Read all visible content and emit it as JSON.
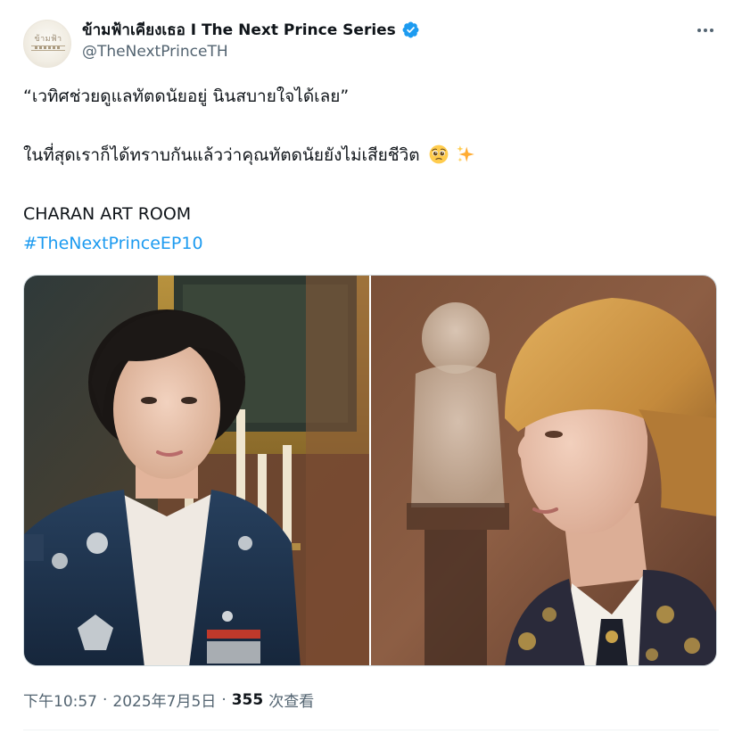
{
  "author": {
    "display_name": "ข้ามฟ้าเคียงเธอ I The Next Prince Series",
    "handle": "@TheNextPrinceTH",
    "avatar_logo_text": "ข้ามฟ้า",
    "verified": true
  },
  "tweet": {
    "lines": [
      "“เวทิศช่วยดูแลทัตดนัยอยู่ นินสบายใจได้เลย”",
      "",
      "ในที่สุดเราก็ได้ทราบกันแล้วว่าคุณทัตดนัยยังไม่เสียชีวิต",
      "",
      "CHARAN ART ROOM"
    ],
    "emojis": [
      "pleading-face-icon",
      "sparkles-icon"
    ],
    "hashtag": "#TheNextPrinceEP10"
  },
  "media": {
    "images": [
      {
        "name": "photo-man-dark-hair-uniform"
      },
      {
        "name": "photo-man-blonde-hair-profile"
      }
    ]
  },
  "meta": {
    "time": "下午10:57",
    "separator": "·",
    "date": "2025年7月5日",
    "views_count": "355",
    "views_label": "次查看"
  },
  "colors": {
    "link": "#1d9bf0",
    "verified": "#1d9bf0",
    "secondary_text": "#536471",
    "primary_text": "#0f1419"
  }
}
